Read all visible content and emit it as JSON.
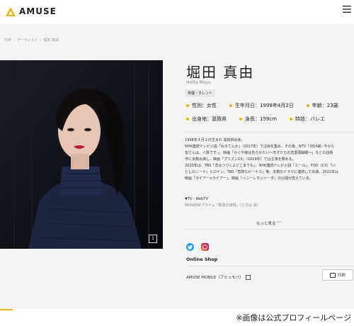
{
  "header": {
    "logo_text": "AMUSE",
    "menu_icon": "hamburger-icon"
  },
  "breadcrumb": [
    "TOP",
    "›",
    "アーティスト",
    "›",
    "堀田 真由"
  ],
  "profile": {
    "name": "堀田 真由",
    "name_roman": "Hotta Mayu",
    "category": "俳優・タレント",
    "facts_row1": [
      {
        "label": "性別：女性"
      },
      {
        "label": "生年月日：1998年4月2日"
      },
      {
        "label": "年齢：23歳"
      }
    ],
    "facts_row2": [
      {
        "label": "出身地：滋賀県"
      },
      {
        "label": "身長：159cm"
      },
      {
        "label": "特技：バレエ"
      }
    ],
    "bio": [
      "1998年４月２日生まれ 滋賀県出身。",
      "NHK連続テレビ小説「わろてんか」（2017年）で注目を集め、その後、NTV「3年A組 ‐今から",
      "皆さんは、人質です‐」、映画「かぐや様は告らせたい～天才たちの恋愛頭脳戦～」などの話題",
      "作に多数出演し、映画「プリズン13」（2019年）では主演を務める。",
      "2020年は、TBS「恋はつづくよどこまでも」、NHK連続テレビ小説「エール」、FOD（CX）「い",
      "としのニーナ」ヒロイン、TBS「危険なビーナス」等、多数のドラマに連続して出演。2021年は",
      "映画「ライアー×ライアー」、映画「ハニーレモンソーダ」の公開が控えている。"
    ],
    "works_heading": "▼TV・WebTV",
    "works_item": "WOWOWプライム「殺意の道程」（どのは 役）",
    "more_label": "もっと見る ﹀"
  },
  "photo": {
    "counter": "1"
  },
  "social": {
    "twitter_icon": "twitter-icon",
    "instagram_icon": "instagram-icon"
  },
  "shop": {
    "online_shop_label": "Online Shop",
    "mobile_label": "AMUSE MOBILE（アミュモバ）",
    "print_label": "印刷"
  },
  "caption": "※画像は公式プロフィールページ",
  "colors": {
    "accent": "#f0b400",
    "twitter": "#1da1f2"
  }
}
